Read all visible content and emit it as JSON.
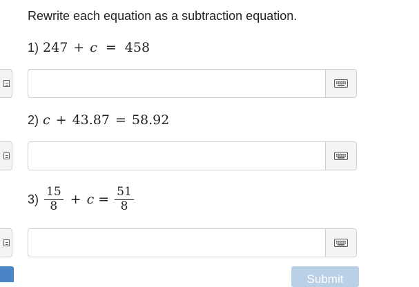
{
  "instruction": "Rewrite each equation as a subtraction equation.",
  "problems": [
    {
      "number": "1)",
      "left": "247",
      "op1": "+",
      "var": "c",
      "eq": "=",
      "right": "458",
      "answer_value": "",
      "keyboard_icon": "keyboard-icon"
    },
    {
      "number": "2)",
      "var": "c",
      "op1": "+",
      "middle": "43.87",
      "eq": "=",
      "right": "58.92",
      "answer_value": "",
      "keyboard_icon": "keyboard-icon"
    },
    {
      "number": "3)",
      "frac1": {
        "num": "15",
        "den": "8"
      },
      "op1": "+",
      "var": "c",
      "eq": "=",
      "frac2": {
        "num": "51",
        "den": "8"
      },
      "answer_value": "",
      "keyboard_icon": "keyboard-icon"
    }
  ],
  "submit": {
    "label": "Submit",
    "state": "disabled"
  },
  "colors": {
    "submit_bg": "#b9d0e6",
    "left_tab": "#4a86c5",
    "border": "#cfcfcf"
  }
}
